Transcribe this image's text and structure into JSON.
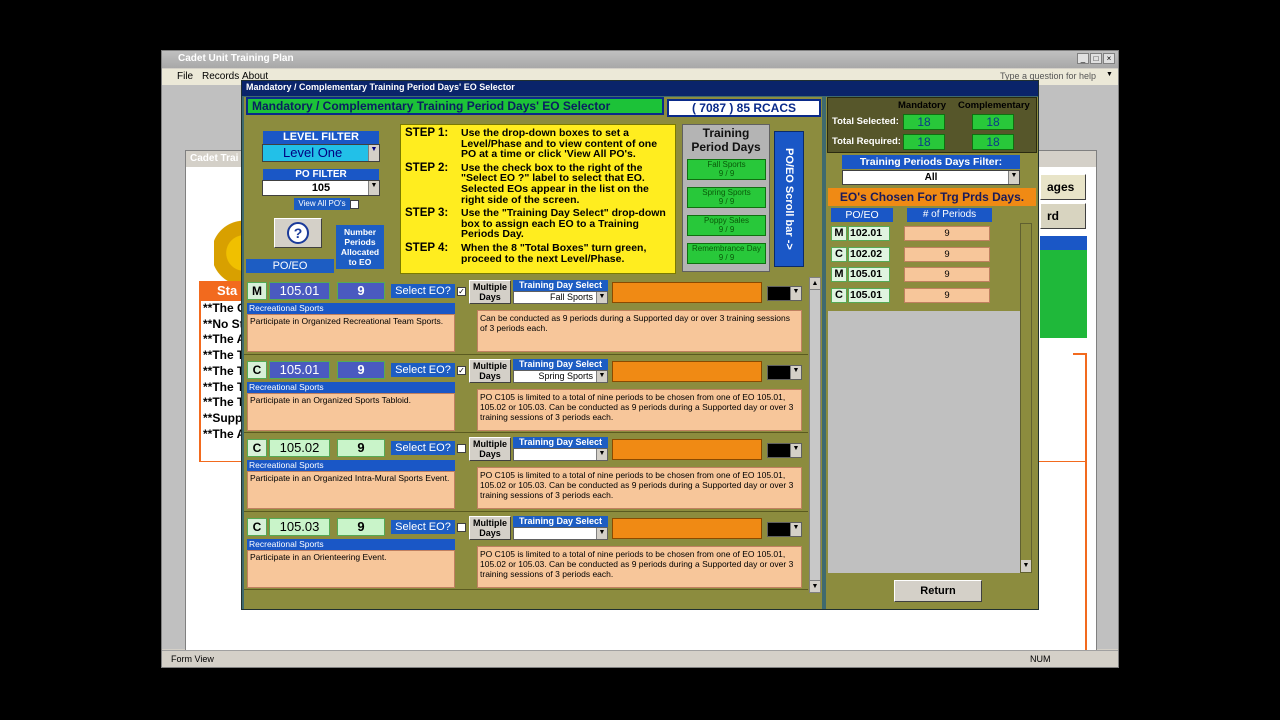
{
  "app": {
    "title": "Cadet Unit Training Plan",
    "menu": [
      "File",
      "Records",
      "About"
    ],
    "help_placeholder": "Type a question for help",
    "status_left": "Form View",
    "status_right": "NUM"
  },
  "bgform": {
    "title": "Cadet Trai",
    "right_btn1": "ages",
    "right_btn2": "rd",
    "status_header": "Sta",
    "status_lines": [
      "**The C",
      "**No St",
      "**The A",
      "**The T",
      "**The T",
      "**The T",
      "**The T",
      "**Supp",
      "**The A"
    ]
  },
  "dialog": {
    "title": "Mandatory / Complementary Training Period Days' EO Selector",
    "header": "Mandatory / Complementary Training Period Days' EO Selector",
    "unit": "( 7087 ) 85 RCACS",
    "level_filter_label": "LEVEL FILTER",
    "level_filter_value": "Level One",
    "po_filter_label": "PO FILTER",
    "po_filter_value": "105",
    "view_all_label": "View All PO's",
    "help_icon": "?",
    "num_periods_label": "Number Periods Allocated to EO",
    "poeo_label": "PO/EO",
    "steps": [
      {
        "num": "STEP 1:",
        "text": "Use the drop-down boxes to set a Level/Phase and to view content of one PO at a time or click 'View All PO's."
      },
      {
        "num": "STEP 2:",
        "text": "Use the check box to the right of the \"Select EO ?\" label to select that EO. Selected EOs appear in the list on the right side of the screen."
      },
      {
        "num": "STEP 3:",
        "text": "Use the \"Training Day Select\" drop-down box to assign each EO to a Training Periods Day."
      },
      {
        "num": "STEP 4:",
        "text": "When the 8 \"Total Boxes\" turn green, proceed to the next Level/Phase."
      }
    ],
    "training_days_title": "Training Period Days",
    "training_days": [
      {
        "name": "Fall Sports",
        "count": "9 / 9"
      },
      {
        "name": "Spring Sports",
        "count": "9 / 9"
      },
      {
        "name": "Poppy Sales",
        "count": "9 / 9"
      },
      {
        "name": "Remembrance Day",
        "count": "9 / 9"
      }
    ],
    "scroll_bar_label": "PO/EO Scroll bar ->",
    "select_eo_label": "Select EO?",
    "multiple_days_label": "Multiple Days",
    "training_day_select_label": "Training Day Select",
    "rows": [
      {
        "type": "M",
        "eo": "105.01",
        "periods": "9",
        "checked": true,
        "day": "Fall Sports",
        "category": "Recreational Sports",
        "title": "Participate in Organized Recreational Team Sports.",
        "note": "Can be conducted as 9 periods during a Supported day or over 3 training sessions of 3 periods each."
      },
      {
        "type": "C",
        "eo": "105.01",
        "periods": "9",
        "checked": true,
        "day": "Spring Sports",
        "category": "Recreational Sports",
        "title": "Participate in an Organized Sports Tabloid.",
        "note": "PO C105 is limited to a total of nine periods to be chosen from one of EO 105.01, 105.02 or 105.03.  Can be conducted as 9 periods during a Supported day or over 3 training sessions of 3 periods each."
      },
      {
        "type": "C",
        "eo": "105.02",
        "periods": "9",
        "checked": false,
        "day": "",
        "category": "Recreational Sports",
        "title": "Participate in an Organized Intra-Mural Sports Event.",
        "note": "PO C105 is limited to a total of nine periods to be chosen from one of EO 105.01, 105.02 or 105.03.  Can be conducted as 9 periods during a Supported day or over 3 training sessions of 3 periods each."
      },
      {
        "type": "C",
        "eo": "105.03",
        "periods": "9",
        "checked": false,
        "day": "",
        "category": "Recreational Sports",
        "title": "Participate in an Orienteering Event.",
        "note": "PO C105 is limited to a total of nine periods to be chosen from one of EO 105.01, 105.02 or 105.03.  Can be conducted as 9 periods during a Supported day or over 3 training sessions of 3 periods each."
      }
    ],
    "totals": {
      "mandatory_label": "Mandatory",
      "complementary_label": "Complementary",
      "selected_label": "Total Selected:",
      "required_label": "Total Required:",
      "selected_m": "18",
      "selected_c": "18",
      "required_m": "18",
      "required_c": "18"
    },
    "tpd_filter_label": "Training Periods Days Filter:",
    "tpd_filter_value": "All",
    "chosen_header": "EO's Chosen For Trg Prds Days.",
    "chosen_col1": "PO/EO",
    "chosen_col2": "# of Periods",
    "chosen": [
      {
        "type": "M",
        "eo": "102.01",
        "periods": "9"
      },
      {
        "type": "C",
        "eo": "102.02",
        "periods": "9"
      },
      {
        "type": "M",
        "eo": "105.01",
        "periods": "9"
      },
      {
        "type": "C",
        "eo": "105.01",
        "periods": "9"
      }
    ],
    "return_label": "Return"
  }
}
